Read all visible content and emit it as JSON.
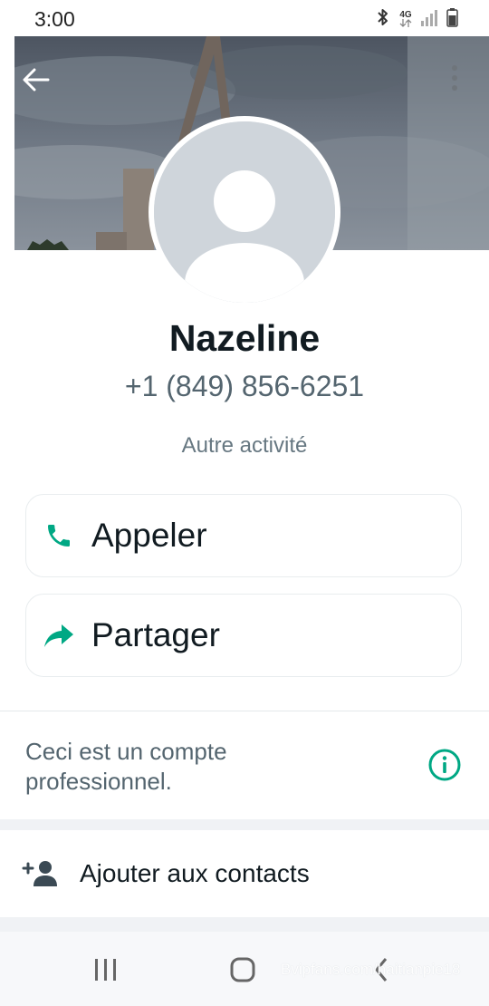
{
  "status_bar": {
    "time": "3:00",
    "network_type": "4G",
    "icons": [
      "bluetooth-icon",
      "network-4g-icon",
      "signal-icon",
      "battery-icon"
    ]
  },
  "header": {
    "back_icon": "arrow-left-icon",
    "menu_icon": "more-vertical-icon"
  },
  "profile": {
    "name": "Nazeline",
    "phone": "+1 (849) 856-6251",
    "activity_label": "Autre activité"
  },
  "actions": [
    {
      "label": "Appeler",
      "icon": "phone-icon"
    },
    {
      "label": "Partager",
      "icon": "share-icon"
    }
  ],
  "business_notice": {
    "text": "Ceci est un compte professionnel.",
    "icon": "info-icon"
  },
  "add_contact": {
    "label": "Ajouter aux contacts",
    "icon": "add-person-icon"
  },
  "watermark": "Bvipfans.com/haitianpie18",
  "colors": {
    "accent": "#00a884",
    "text_primary": "#111b21",
    "text_secondary": "#54656f"
  }
}
